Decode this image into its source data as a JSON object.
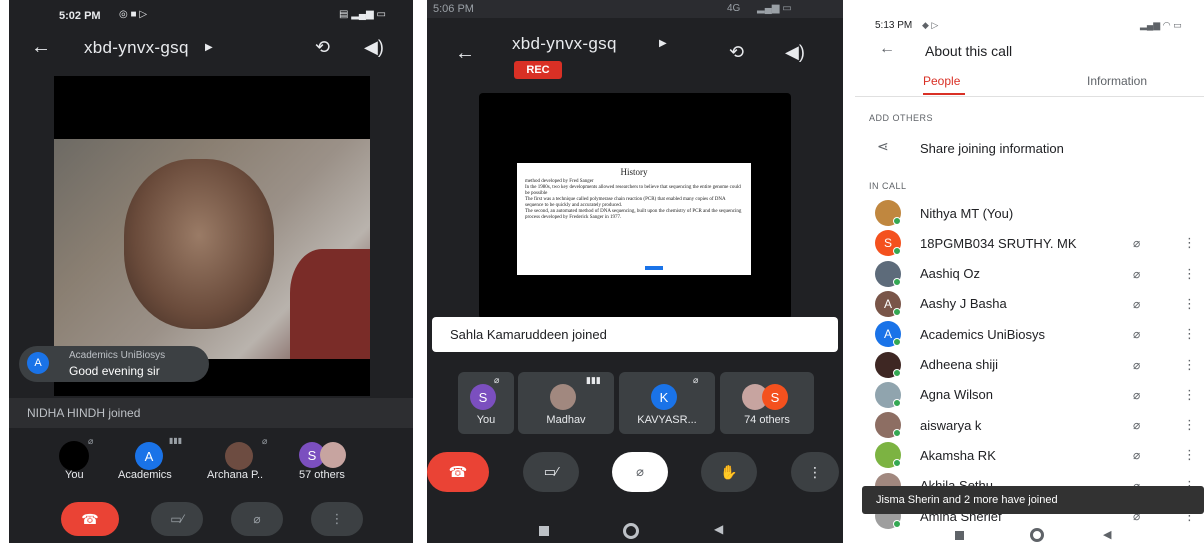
{
  "colors": {
    "accent": "#ea4335",
    "blue": "#1a73e8",
    "dark": "#202124",
    "tile": "#3c4043"
  },
  "screen1": {
    "time": "5:02 PM",
    "meeting_code": "xbd-ynvx-gsq",
    "chat": {
      "author": "Academics UniBiosys",
      "message": "Good evening sir",
      "initial": "A"
    },
    "toast": "NIDHA HINDH joined",
    "participants": [
      {
        "label": "You",
        "initial": ""
      },
      {
        "label": "Academics",
        "initial": "A"
      },
      {
        "label": "Archana P..",
        "initial": ""
      },
      {
        "label": "57 others",
        "initial": "S"
      }
    ]
  },
  "screen2": {
    "time": "5:06 PM",
    "network": "4G",
    "meeting_code": "xbd-ynvx-gsq",
    "rec_label": "REC",
    "slide": {
      "title": "History",
      "bullets": [
        "method developed by Fred Sanger",
        "In the 1980s, two key developments allowed researchers to believe that sequencing the entire genome could be possible",
        "The first was a technique called polymerase chain reaction (PCR) that enabled many copies of DNA sequence to be quickly and accurately produced.",
        "The second, an automated method of DNA sequencing, built upon the chemistry of PCR and the sequencing process developed by Frederick Sanger in 1977."
      ]
    },
    "toast": "Sahla Kamaruddeen joined",
    "participants": [
      {
        "label": "You",
        "initial": "S"
      },
      {
        "label": "Madhav",
        "initial": ""
      },
      {
        "label": "KAVYASR...",
        "initial": "K"
      },
      {
        "label": "74 others",
        "initial": "S"
      }
    ]
  },
  "screen3": {
    "time": "5:13 PM",
    "header": "About this call",
    "tabs": [
      "People",
      "Information"
    ],
    "add_others_label": "ADD OTHERS",
    "share_label": "Share joining information",
    "in_call_label": "IN CALL",
    "people": [
      {
        "name": "Nithya MT (You)",
        "initial": "",
        "color": "#c0873f",
        "muted": false
      },
      {
        "name": "18PGMB034 SRUTHY. MK",
        "initial": "S",
        "color": "#f4511e",
        "muted": true
      },
      {
        "name": "Aashiq Oz",
        "initial": "",
        "color": "#5d6b7a",
        "muted": true
      },
      {
        "name": "Aashy J Basha",
        "initial": "A",
        "color": "#795548",
        "muted": true
      },
      {
        "name": "Academics UniBiosys",
        "initial": "A",
        "color": "#1a73e8",
        "muted": true
      },
      {
        "name": "Adheena shiji",
        "initial": "",
        "color": "#3e2723",
        "muted": true
      },
      {
        "name": "Agna Wilson",
        "initial": "",
        "color": "#90a4ae",
        "muted": true
      },
      {
        "name": "aiswarya k",
        "initial": "",
        "color": "#8d6e63",
        "muted": true
      },
      {
        "name": "Akamsha RK",
        "initial": "",
        "color": "#7cb342",
        "muted": true
      },
      {
        "name": "Akhila Sethu",
        "initial": "",
        "color": "#a1887f",
        "muted": true
      },
      {
        "name": "Amina Sherief",
        "initial": "",
        "color": "#9e9e9e",
        "muted": true
      }
    ],
    "snackbar": "Jisma Sherin and 2 more have joined"
  }
}
